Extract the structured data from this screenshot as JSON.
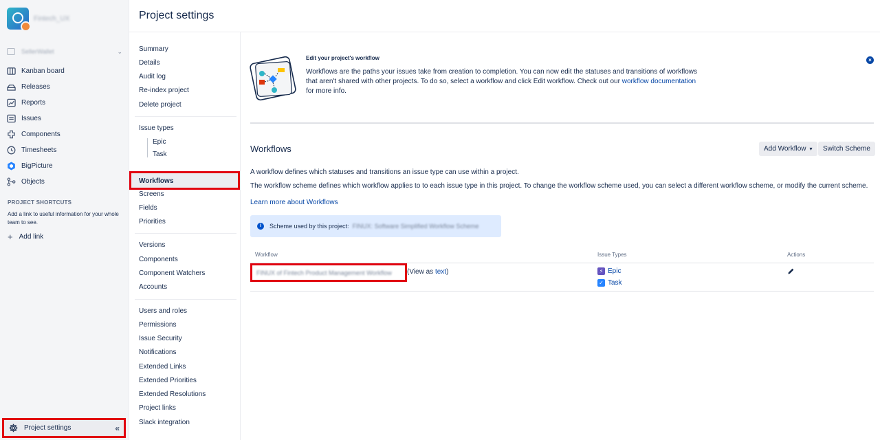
{
  "sidebar": {
    "project_name": "Fintech_UX",
    "board_selector": "SellerWallet",
    "items": [
      {
        "label": "Kanban board",
        "icon": "kanban-icon"
      },
      {
        "label": "Releases",
        "icon": "releases-icon"
      },
      {
        "label": "Reports",
        "icon": "reports-icon"
      },
      {
        "label": "Issues",
        "icon": "issues-icon"
      },
      {
        "label": "Components",
        "icon": "components-icon"
      },
      {
        "label": "Timesheets",
        "icon": "timesheets-icon"
      },
      {
        "label": "BigPicture",
        "icon": "bigpicture-icon"
      },
      {
        "label": "Objects",
        "icon": "objects-icon"
      }
    ],
    "shortcuts_title": "PROJECT SHORTCUTS",
    "shortcuts_text": "Add a link to useful information for your whole team to see.",
    "add_link": "Add link",
    "project_settings": "Project settings"
  },
  "page": {
    "title": "Project settings"
  },
  "menu": {
    "group1": [
      "Summary",
      "Details",
      "Audit log",
      "Re-index project",
      "Delete project"
    ],
    "issue_types_label": "Issue types",
    "issue_types": [
      "Epic",
      "Task"
    ],
    "active": "Workflows",
    "group3": [
      "Screens",
      "Fields",
      "Priorities"
    ],
    "group4": [
      "Versions",
      "Components",
      "Component Watchers",
      "Accounts"
    ],
    "group5": [
      "Users and roles",
      "Permissions",
      "Issue Security",
      "Notifications",
      "Extended Links",
      "Extended Priorities",
      "Extended Resolutions",
      "Project links",
      "Slack integration"
    ]
  },
  "banner": {
    "title": "Edit your project's workflow",
    "text": "Workflows are the paths your issues take from creation to completion. You can now edit the statuses and transitions of workflows that aren't shared with other projects. To do so, select a workflow and click Edit workflow. Check out our",
    "link": "workflow documentation",
    "text_end": "for more info."
  },
  "workflows": {
    "title": "Workflows",
    "add_button": "Add Workflow",
    "switch_button": "Switch Scheme",
    "desc1": "A workflow defines which statuses and transitions an issue type can use within a project.",
    "desc2": "The workflow scheme defines which workflow applies to to each issue type in this project. To change the workflow scheme used, you can select a different workflow scheme, or modify the current scheme.",
    "learn_more": "Learn more about Workflows",
    "scheme_label": "Scheme used by this project:",
    "scheme_name": "FINUX: Software Simplified Workflow Scheme",
    "columns": [
      "Workflow",
      "Issue Types",
      "Actions"
    ],
    "row": {
      "workflow_name": "FINUX of Fintech Product Management Workflow",
      "view_as_prefix": "(View as ",
      "view_as_link": "text",
      "view_as_suffix": ")",
      "issue_types": [
        "Epic",
        "Task"
      ]
    }
  },
  "colors": {
    "accent": "#0747a6",
    "highlight_border": "#e1000f",
    "epic": "#6554c0",
    "task": "#2684ff"
  }
}
